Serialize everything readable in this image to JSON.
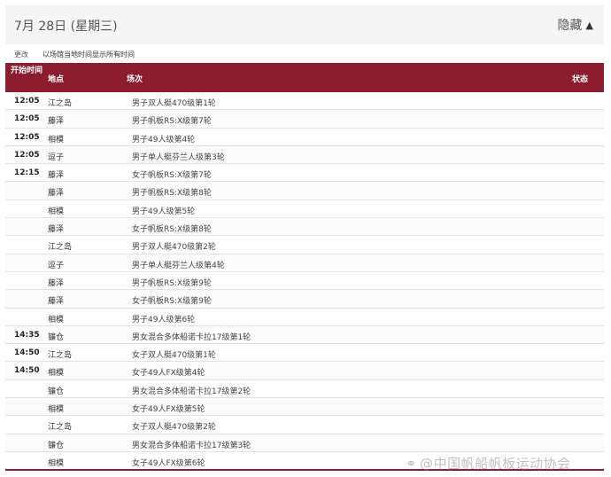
{
  "header": {
    "date": "7月 28日 (星期三)",
    "hide_label": "隐藏",
    "chevron": "chevron-up-icon"
  },
  "subbar": {
    "change_label": "更改",
    "note": "以场馆当地时间显示所有时间"
  },
  "table": {
    "columns": {
      "time": "开始时间",
      "venue": "地点",
      "event": "场次",
      "status": "状态"
    },
    "rows": [
      {
        "time": "12:05",
        "venue": "江之岛",
        "event": "男子双人艇470级第1轮",
        "status": ""
      },
      {
        "time": "12:05",
        "venue": "藤泽",
        "event": "男子帆板RS:X级第7轮",
        "status": ""
      },
      {
        "time": "12:05",
        "venue": "相模",
        "event": "男子49人级第4轮",
        "status": ""
      },
      {
        "time": "12:05",
        "venue": "逗子",
        "event": "男子单人艇芬兰人级第3轮",
        "status": ""
      },
      {
        "time": "12:15",
        "venue": "藤泽",
        "event": "女子帆板RS:X级第7轮",
        "status": ""
      },
      {
        "time": "",
        "venue": "藤泽",
        "event": "男子帆板RS:X级第8轮",
        "status": ""
      },
      {
        "time": "",
        "venue": "相模",
        "event": "男子49人级第5轮",
        "status": ""
      },
      {
        "time": "",
        "venue": "藤泽",
        "event": "女子帆板RS:X级第8轮",
        "status": ""
      },
      {
        "time": "",
        "venue": "江之岛",
        "event": "男子双人艇470级第2轮",
        "status": ""
      },
      {
        "time": "",
        "venue": "逗子",
        "event": "男子单人艇芬兰人级第4轮",
        "status": ""
      },
      {
        "time": "",
        "venue": "藤泽",
        "event": "男子帆板RS:X级第9轮",
        "status": ""
      },
      {
        "time": "",
        "venue": "藤泽",
        "event": "女子帆板RS:X级第9轮",
        "status": ""
      },
      {
        "time": "",
        "venue": "相模",
        "event": "男子49人级第6轮",
        "status": ""
      },
      {
        "time": "14:35",
        "venue": "镰仓",
        "event": "男女混合多体船诺卡拉17级第1轮",
        "status": ""
      },
      {
        "time": "14:50",
        "venue": "江之岛",
        "event": "女子双人艇470级第1轮",
        "status": ""
      },
      {
        "time": "14:50",
        "venue": "相模",
        "event": "女子49人FX级第4轮",
        "status": ""
      },
      {
        "time": "",
        "venue": "镰仓",
        "event": "男女混合多体船诺卡拉17级第2轮",
        "status": ""
      },
      {
        "time": "",
        "venue": "相模",
        "event": "女子49人FX级第5轮",
        "status": ""
      },
      {
        "time": "",
        "venue": "江之岛",
        "event": "女子双人艇470级第2轮",
        "status": ""
      },
      {
        "time": "",
        "venue": "镰仓",
        "event": "男女混合多体船诺卡拉17级第3轮",
        "status": ""
      },
      {
        "time": "",
        "venue": "相模",
        "event": "女子49人FX级第6轮",
        "status": ""
      }
    ]
  },
  "watermark": {
    "icon": "weibo-icon",
    "text": "@中国帆船帆板运动协会"
  },
  "colors": {
    "header_bg": "#8a1e30",
    "accent": "#8a1e30"
  }
}
